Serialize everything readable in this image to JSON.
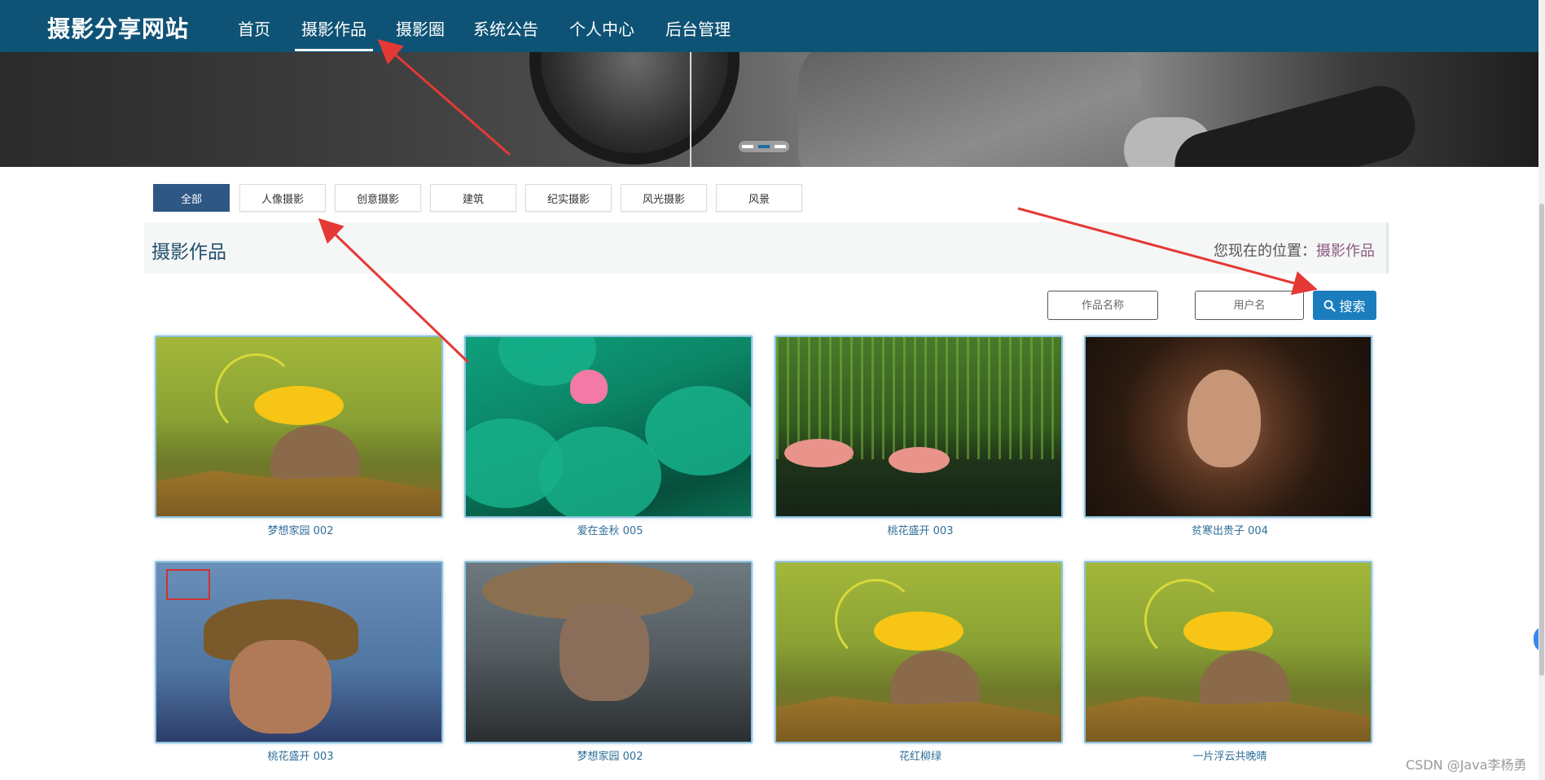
{
  "header": {
    "brand": "摄影分享网站",
    "nav": [
      {
        "label": "首页"
      },
      {
        "label": "摄影作品",
        "active": true
      },
      {
        "label": "摄影圈"
      },
      {
        "label": "系统公告"
      },
      {
        "label": "个人中心"
      },
      {
        "label": "后台管理"
      }
    ]
  },
  "banner": {
    "dots": 3,
    "active_dot": 2
  },
  "categories": [
    {
      "label": "全部",
      "active": true
    },
    {
      "label": "人像摄影"
    },
    {
      "label": "创意摄影"
    },
    {
      "label": "建筑"
    },
    {
      "label": "纪实摄影"
    },
    {
      "label": "风光摄影"
    },
    {
      "label": "风景"
    }
  ],
  "section": {
    "title": "摄影作品",
    "breadcrumb_prefix": "您现在的位置：",
    "breadcrumb_current": "摄影作品"
  },
  "search": {
    "work_name_placeholder": "作品名称",
    "username_placeholder": "用户名",
    "button_label": "搜索"
  },
  "gallery": [
    {
      "caption": "梦想家园 002",
      "icon": "squirrel-photo"
    },
    {
      "caption": "爱在金秋 005",
      "icon": "lotus-photo"
    },
    {
      "caption": "桃花盛开 003",
      "icon": "flamingo-photo"
    },
    {
      "caption": "贫寒出贵子 004",
      "icon": "portrait-photo"
    },
    {
      "caption": "桃花盛开 003",
      "icon": "old-man-pipe-photo"
    },
    {
      "caption": "梦想家园 002",
      "icon": "old-man-hat-photo"
    },
    {
      "caption": "花红柳绿",
      "icon": "squirrel-photo"
    },
    {
      "caption": "一片浮云共晚晴",
      "icon": "squirrel-photo"
    }
  ],
  "watermark": "CSDN @Java李杨勇",
  "colors": {
    "navbar": "#0e5375",
    "active_tab": "#2e5784",
    "search_button": "#1b7dbd",
    "caption": "#2e6e98",
    "annotation_arrow": "#e53935"
  }
}
